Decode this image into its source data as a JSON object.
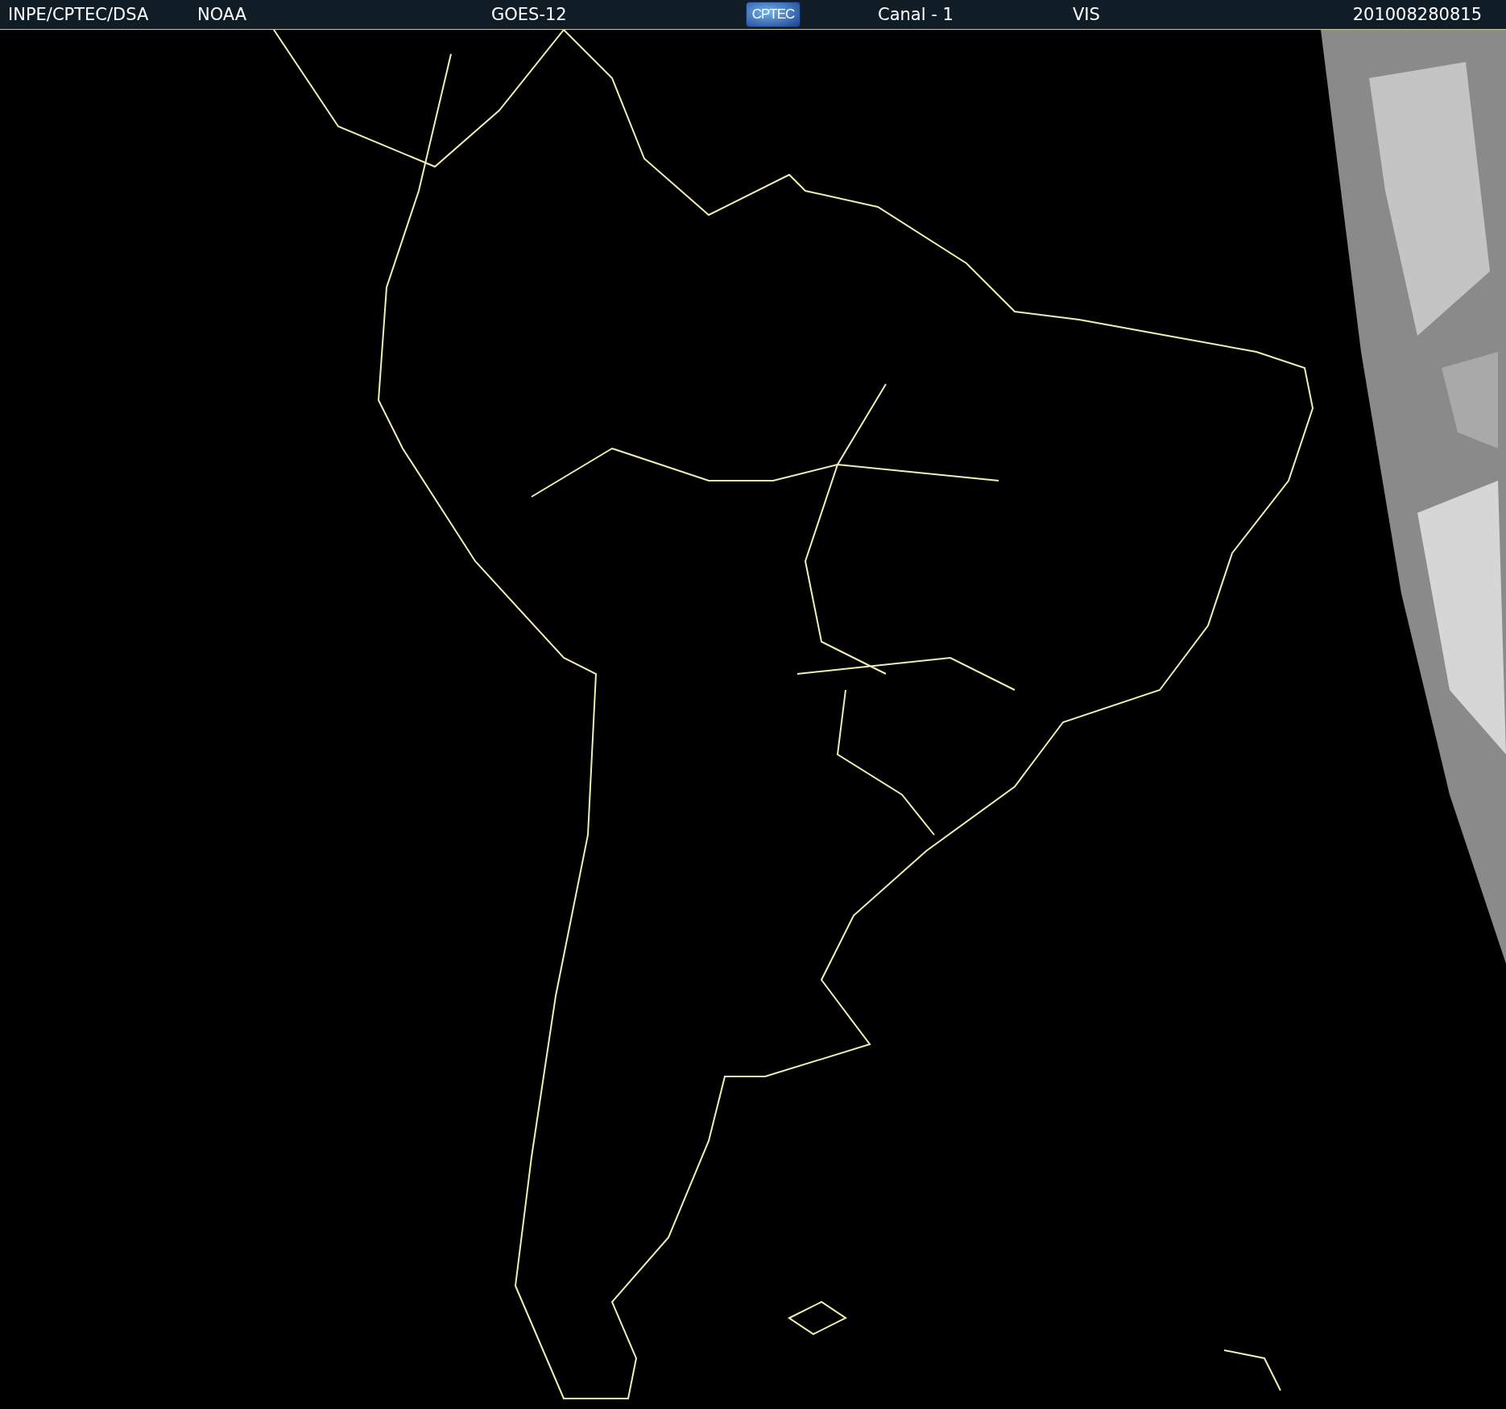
{
  "header": {
    "source": "INPE/CPTEC/DSA",
    "agency": "NOAA",
    "satellite": "GOES-12",
    "logo": "CPTEC",
    "channel": "Canal - 1",
    "band": "VIS",
    "timestamp": "201008280815"
  }
}
